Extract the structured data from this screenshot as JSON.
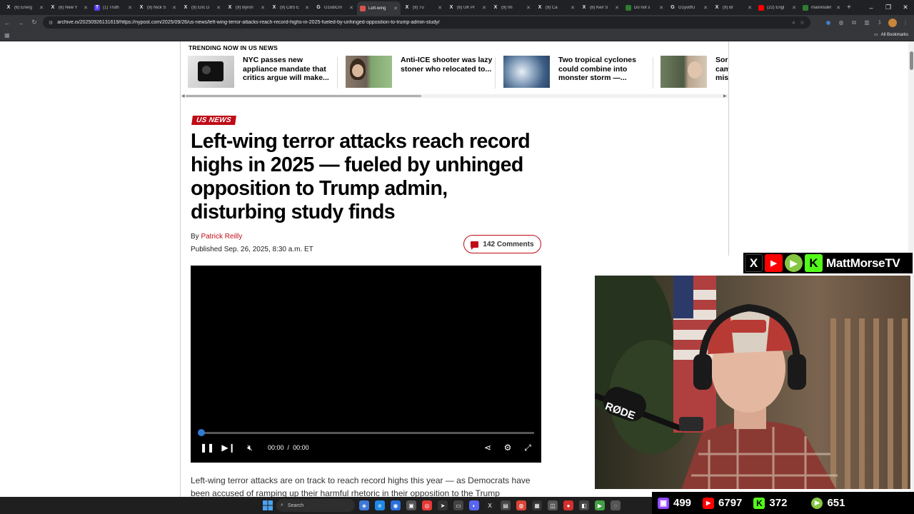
{
  "browser": {
    "tabs": [
      {
        "icon": "X",
        "title": "(6) Energ",
        "active": false
      },
      {
        "icon": "X",
        "title": "(6) New Y",
        "active": false
      },
      {
        "icon": "T",
        "title": "(1) Truth",
        "active": false
      },
      {
        "icon": "X",
        "title": "(9) Nick S",
        "active": false
      },
      {
        "icon": "X",
        "title": "(9) Eric D",
        "active": false
      },
      {
        "icon": "X",
        "title": "(9) Byron",
        "active": false
      },
      {
        "icon": "X",
        "title": "(9) CBS E",
        "active": false
      },
      {
        "icon": "G",
        "title": "G1xdiCm",
        "active": false
      },
      {
        "icon": "a",
        "title": "Left-wing",
        "active": true
      },
      {
        "icon": "X",
        "title": "(9) Tu",
        "active": false
      },
      {
        "icon": "X",
        "title": "(6) UK Pr",
        "active": false
      },
      {
        "icon": "X",
        "title": "(9) Im",
        "active": false
      },
      {
        "icon": "X",
        "title": "(9) Ca",
        "active": false
      },
      {
        "icon": "X",
        "title": "(8) Keir S",
        "active": false
      },
      {
        "icon": "g",
        "title": "Do not s",
        "active": false
      },
      {
        "icon": "G",
        "title": "G1yvdfU",
        "active": false
      },
      {
        "icon": "X",
        "title": "(9) Br",
        "active": false
      },
      {
        "icon": "y",
        "title": "(22) Engl",
        "active": false
      },
      {
        "icon": "g",
        "title": "maxresdef",
        "active": false
      }
    ],
    "new_tab": "+",
    "url": "archive.is/20250926131619/https://nypost.com/2025/09/26/us-news/left-wing-terror-attacks-reach-record-highs-in-2025-fueled-by-unhinged-opposition-to-trump-admin-study/",
    "all_bookmarks": "All Bookmarks"
  },
  "page": {
    "trending_label": "TRENDING NOW IN US NEWS",
    "trending": [
      {
        "text": "NYC passes new appliance mandate that critics argue will make..."
      },
      {
        "text": "Anti-ICE shooter was lazy stoner who relocated to..."
      },
      {
        "text": "Two tropical cyclones could combine into monster storm —..."
      },
      {
        "text": "Sor cam mis"
      }
    ],
    "section_tag": "US NEWS",
    "headline": "Left-wing terror attacks reach record highs in 2025 — fueled by unhinged opposition to Trump admin, disturbing study finds",
    "by_prefix": "By",
    "author": "Patrick Reilly",
    "published": "Published Sep. 26, 2025, 8:30 a.m. ET",
    "comments": "142 Comments",
    "video": {
      "current_time": "00:00",
      "separator": "/",
      "duration": "00:00",
      "progress": 0.0
    },
    "body": "Left-wing terror attacks are on track to reach record highs this year — as Democrats have been accused of ramping up their harmful rhetoric in their opposition to the Trump"
  },
  "overlay": {
    "channel_name": "MattMorseTV",
    "mic_brand": "RØDE",
    "stats": [
      {
        "platform": "twitch",
        "count": "499"
      },
      {
        "platform": "youtube",
        "count": "6797"
      },
      {
        "platform": "kick",
        "count": "372"
      },
      {
        "platform": "rumble",
        "count": "651"
      }
    ]
  },
  "taskbar": {
    "search_placeholder": "Search"
  },
  "colors": {
    "nypost_red": "#c00c17",
    "chrome_dark": "#202124",
    "chrome_toolbar": "#35363a",
    "video_accent": "#2f7bd6"
  }
}
